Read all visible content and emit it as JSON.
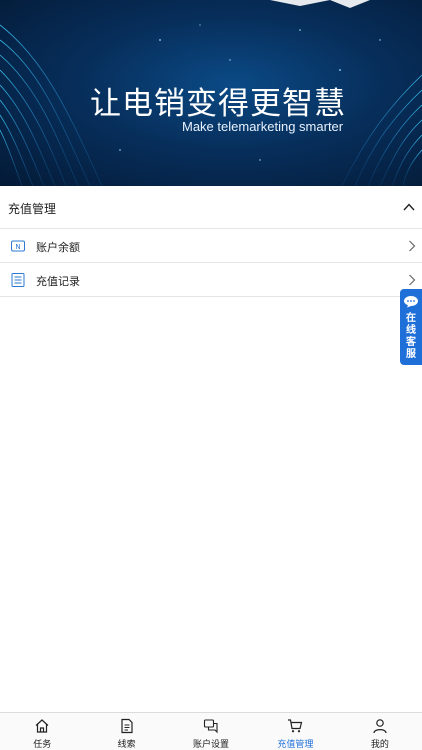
{
  "banner": {
    "title": "让电销变得更智慧",
    "subtitle": "Make telemarketing smarter"
  },
  "section": {
    "title": "充值管理",
    "expanded": true
  },
  "menu": {
    "items": [
      {
        "label": "账户余额",
        "icon": "balance-card-icon"
      },
      {
        "label": "充值记录",
        "icon": "record-list-icon"
      }
    ]
  },
  "service": {
    "label": "在线客服",
    "color": "#1e6fd8"
  },
  "tabbar": {
    "active_color": "#1e6fd8",
    "items": [
      {
        "label": "任务",
        "icon": "home-icon",
        "active": false
      },
      {
        "label": "线索",
        "icon": "document-icon",
        "active": false
      },
      {
        "label": "账户设置",
        "icon": "chat-icon",
        "active": false
      },
      {
        "label": "充值管理",
        "icon": "cart-icon",
        "active": true
      },
      {
        "label": "我的",
        "icon": "user-icon",
        "active": false
      }
    ]
  }
}
